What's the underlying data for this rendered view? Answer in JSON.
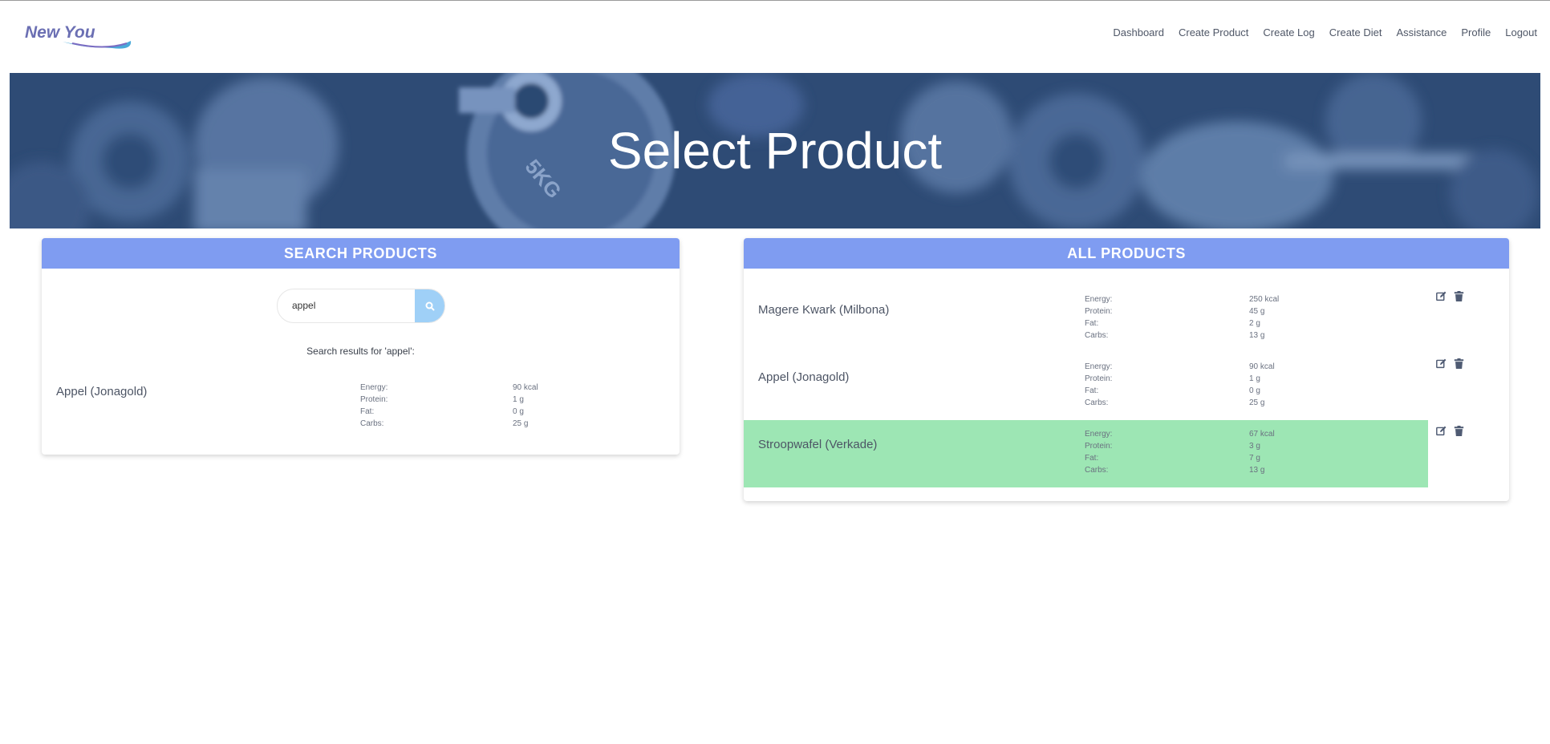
{
  "app": {
    "logo_text": "New You"
  },
  "nav": {
    "items": [
      {
        "label": "Dashboard"
      },
      {
        "label": "Create Product"
      },
      {
        "label": "Create Log"
      },
      {
        "label": "Create Diet"
      },
      {
        "label": "Assistance"
      },
      {
        "label": "Profile"
      },
      {
        "label": "Logout"
      }
    ]
  },
  "hero": {
    "title": "Select Product",
    "weight_plate_text": "5KG"
  },
  "search_panel": {
    "title": "SEARCH PRODUCTS",
    "input_value": "appel",
    "results_title": "Search results for 'appel':",
    "results": [
      {
        "name": "Appel (Jonagold)",
        "nutrients": [
          {
            "label": "Energy:",
            "value": "90 kcal"
          },
          {
            "label": "Protein:",
            "value": "1 g"
          },
          {
            "label": "Fat:",
            "value": "0 g"
          },
          {
            "label": "Carbs:",
            "value": "25 g"
          }
        ]
      }
    ]
  },
  "products_panel": {
    "title": "ALL PRODUCTS",
    "products": [
      {
        "name": "Magere Kwark (Milbona)",
        "highlighted": false,
        "nutrients": [
          {
            "label": "Energy:",
            "value": "250 kcal"
          },
          {
            "label": "Protein:",
            "value": "45 g"
          },
          {
            "label": "Fat:",
            "value": "2 g"
          },
          {
            "label": "Carbs:",
            "value": "13 g"
          }
        ]
      },
      {
        "name": "Appel (Jonagold)",
        "highlighted": false,
        "nutrients": [
          {
            "label": "Energy:",
            "value": "90 kcal"
          },
          {
            "label": "Protein:",
            "value": "1 g"
          },
          {
            "label": "Fat:",
            "value": "0 g"
          },
          {
            "label": "Carbs:",
            "value": "25 g"
          }
        ]
      },
      {
        "name": "Stroopwafel (Verkade)",
        "highlighted": true,
        "nutrients": [
          {
            "label": "Energy:",
            "value": "67 kcal"
          },
          {
            "label": "Protein:",
            "value": "3 g"
          },
          {
            "label": "Fat:",
            "value": "7 g"
          },
          {
            "label": "Carbs:",
            "value": "13 g"
          }
        ]
      }
    ]
  },
  "colors": {
    "panel_header": "#7f9cf1",
    "highlight_row": "#9de6b4",
    "search_button": "#9fd0f7",
    "hero_overlay": "#2f4d78"
  },
  "icons": {
    "search": "search-icon",
    "edit": "edit-icon",
    "delete": "trash-icon"
  }
}
